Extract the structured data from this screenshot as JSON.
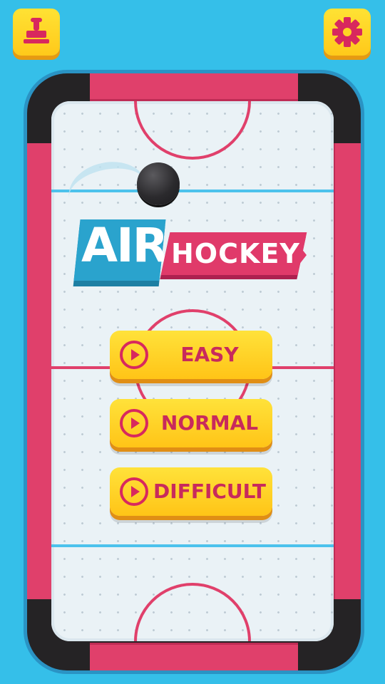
{
  "logo": {
    "word1": "AIR",
    "word2": "HOCKEY"
  },
  "menu": {
    "easy_label": "EASY",
    "normal_label": "NORMAL",
    "difficult_label": "DIFFICULT"
  },
  "icons": {
    "profile": "stamp-icon",
    "settings": "gear-icon",
    "play": "play-icon"
  },
  "colors": {
    "background": "#35bfe9",
    "button": "#ffd423",
    "accent_pink": "#e0406b",
    "line_blue": "#4cc2ec",
    "rink": "#eaf2f6"
  }
}
